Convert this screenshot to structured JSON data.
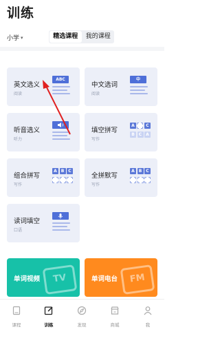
{
  "header": {
    "title": "训练"
  },
  "filter": {
    "grade": "小学"
  },
  "tabs": [
    {
      "label": "精选课程",
      "active": true
    },
    {
      "label": "我的课程",
      "active": false
    }
  ],
  "cards": [
    {
      "title": "英文选义",
      "subtitle": "阅读",
      "badge": "ABC"
    },
    {
      "title": "中文选词",
      "subtitle": "阅读",
      "badge": "中"
    },
    {
      "title": "听音选义",
      "subtitle": "听力",
      "badge": ""
    },
    {
      "title": "填空拼写",
      "subtitle": "写作",
      "letters_top": [
        "A",
        "",
        "C"
      ],
      "letters_bottom": [
        "B",
        "C",
        "A"
      ]
    },
    {
      "title": "组合拼写",
      "subtitle": "写作",
      "letters_top": [
        "A",
        "B",
        "C"
      ],
      "letters_bottom": [
        "",
        "",
        ""
      ]
    },
    {
      "title": "全拼默写",
      "subtitle": "写作",
      "letters_top": [
        "A",
        "B",
        "C"
      ],
      "letters_bottom": [
        "",
        "",
        ""
      ]
    },
    {
      "title": "读词填空",
      "subtitle": "口语",
      "badge": ""
    }
  ],
  "banners": [
    {
      "title": "单词视频",
      "deco": "TV",
      "color": "#17c1a8"
    },
    {
      "title": "单词电台",
      "deco": "FM",
      "color": "#ff8a1e"
    }
  ],
  "nav": [
    {
      "label": "课程",
      "icon": "book-icon",
      "active": false
    },
    {
      "label": "训练",
      "icon": "edit-icon",
      "active": true
    },
    {
      "label": "发现",
      "icon": "compass-icon",
      "active": false
    },
    {
      "label": "商城",
      "icon": "store-icon",
      "active": false
    },
    {
      "label": "我",
      "icon": "person-icon",
      "active": false
    }
  ],
  "colors": {
    "accent": "#4e6fd8",
    "card_bg": "#eceff8",
    "annotation": "#e02020"
  }
}
